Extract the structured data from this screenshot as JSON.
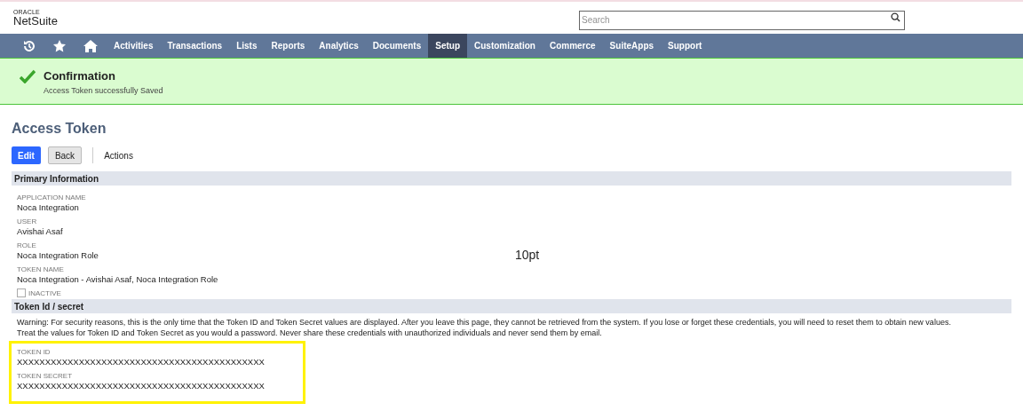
{
  "header": {
    "logo_top": "ORACLE",
    "logo_main": "NetSuite",
    "search": {
      "placeholder": "Search"
    }
  },
  "nav": {
    "icons": [
      {
        "kind": "recent"
      },
      {
        "kind": "favorites"
      },
      {
        "kind": "home"
      }
    ],
    "items": [
      {
        "label": "Activities",
        "selected": false
      },
      {
        "label": "Transactions",
        "selected": false
      },
      {
        "label": "Lists",
        "selected": false
      },
      {
        "label": "Reports",
        "selected": false
      },
      {
        "label": "Analytics",
        "selected": false
      },
      {
        "label": "Documents",
        "selected": false
      },
      {
        "label": "Setup",
        "selected": true
      },
      {
        "label": "Customization",
        "selected": false
      },
      {
        "label": "Commerce",
        "selected": false
      },
      {
        "label": "SuiteApps",
        "selected": false
      },
      {
        "label": "Support",
        "selected": false
      }
    ]
  },
  "confirmation": {
    "title": "Confirmation",
    "message": "Access Token successfully Saved"
  },
  "page_title": "Access Token",
  "buttons": [
    {
      "label": "Edit",
      "kind": "primary"
    },
    {
      "label": "Back",
      "kind": "secondary"
    }
  ],
  "actions": "Actions",
  "primary_information": {
    "title": "Primary Information",
    "fields": [
      {
        "label": "APPLICATION NAME",
        "value": "Noca Integration"
      },
      {
        "label": "USER",
        "value": "Avishai Asaf"
      },
      {
        "label": "ROLE",
        "value": "Noca Integration Role"
      },
      {
        "label": "TOKEN NAME",
        "value": "Noca Integration - Avishai Asaf, Noca Integration Role"
      }
    ],
    "inactive": {
      "label": "INACTIVE",
      "checked": false
    }
  },
  "annotation": "10pt",
  "token_section": {
    "title": "Token Id / secret",
    "warning": [
      "Warning: For security reasons, this is the only time that the Token ID and Token Secret values are displayed. After you leave this page, they cannot be retrieved from the system. If you lose or forget these credentials, you will need to reset them to obtain new values.",
      "Treat the values for Token ID and Token Secret as you would a password. Never share these credentials with unauthorized individuals and never send them by email."
    ],
    "fields": [
      {
        "label": "TOKEN ID",
        "value": "XXXXXXXXXXXXXXXXXXXXXXXXXXXXXXXXXXXXXXXXXXXX"
      },
      {
        "label": "TOKEN SECRET",
        "value": "XXXXXXXXXXXXXXXXXXXXXXXXXXXXXXXXXXXXXXXXXXXX"
      }
    ]
  }
}
